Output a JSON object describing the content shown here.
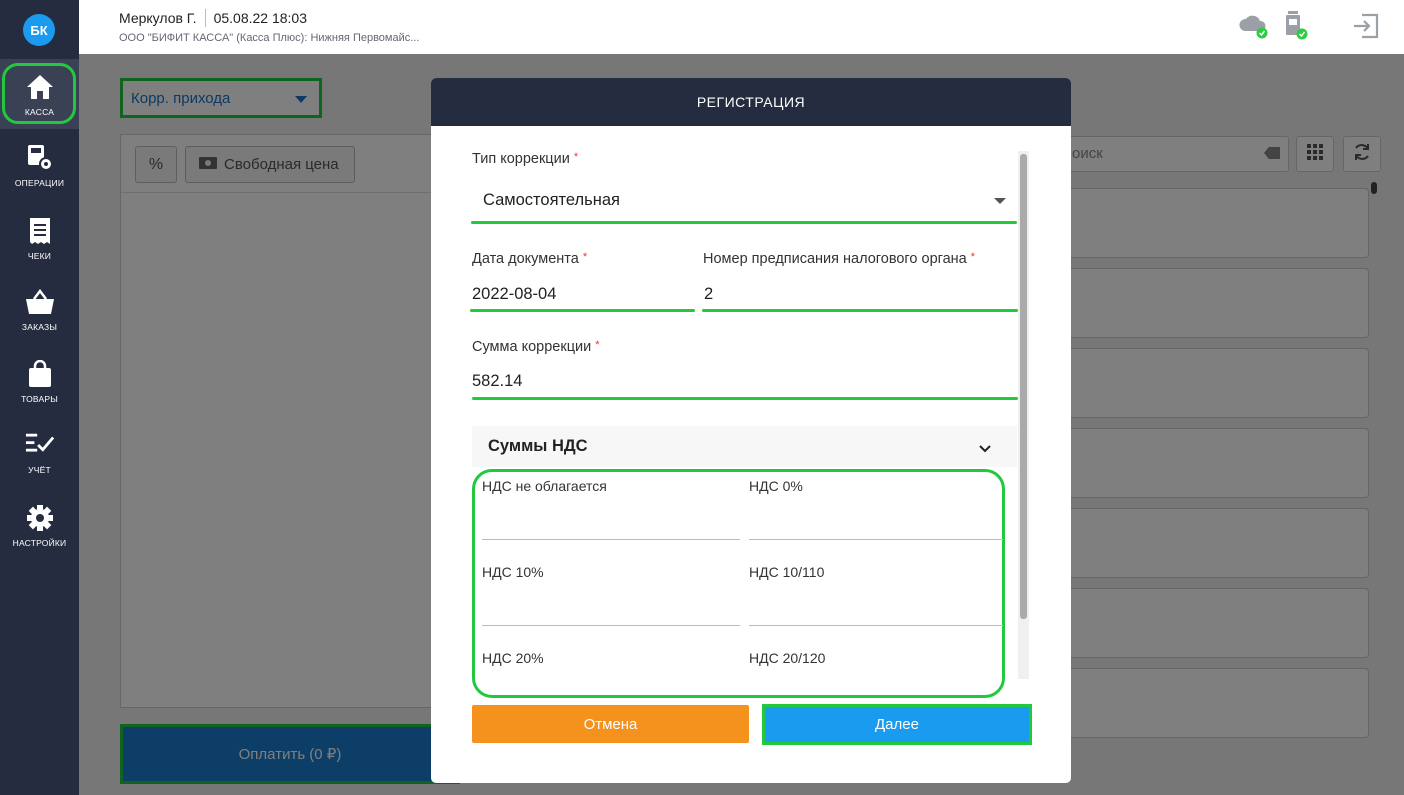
{
  "sidebar": {
    "avatar": "БК",
    "items": [
      {
        "label": "КАССА",
        "icon": "home-icon"
      },
      {
        "label": "ОПЕРАЦИИ",
        "icon": "operations-icon"
      },
      {
        "label": "ЧЕКИ",
        "icon": "receipt-icon"
      },
      {
        "label": "ЗАКАЗЫ",
        "icon": "basket-icon"
      },
      {
        "label": "ТОВАРЫ",
        "icon": "bag-icon"
      },
      {
        "label": "УЧЁТ",
        "icon": "checklist-icon"
      },
      {
        "label": "НАСТРОЙКИ",
        "icon": "gear-icon"
      }
    ]
  },
  "header": {
    "user": "Меркулов Г.",
    "datetime": "05.08.22 18:03",
    "org": "ООО \"БИФИТ КАССА\" (Касса Плюс): Нижняя Первомайс..."
  },
  "main": {
    "doc_type": "Корр. прихода",
    "free_price": "Свободная цена",
    "pay_button": "Оплатить (0 ₽)",
    "search_placeholder": "оиск"
  },
  "modal": {
    "title": "РЕГИСТРАЦИЯ",
    "correction_type_label": "Тип коррекции",
    "correction_type_value": "Самостоятельная",
    "doc_date_label": "Дата документа",
    "doc_date_value": "2022-08-04",
    "order_number_label": "Номер предписания налогового органа",
    "order_number_value": "2",
    "sum_label": "Сумма коррекции",
    "sum_value": "582.14",
    "vat_section_title": "Суммы НДС",
    "vat_fields": [
      {
        "label": "НДС не облагается"
      },
      {
        "label": "НДС 0%"
      },
      {
        "label": "НДС 10%"
      },
      {
        "label": "НДС 10/110"
      },
      {
        "label": "НДС 20%"
      },
      {
        "label": "НДС 20/120"
      }
    ],
    "required_mark": "*",
    "cancel_label": "Отмена",
    "next_label": "Далее"
  },
  "colors": {
    "sidebar_bg": "#262c3f",
    "highlight": "#22c93f",
    "primary": "#1a9bf0",
    "cancel": "#f5921e"
  }
}
